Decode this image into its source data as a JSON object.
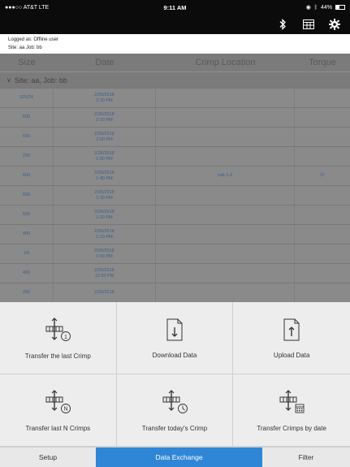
{
  "status_bar": {
    "carrier": "●●●○○ AT&T  LTE",
    "time": "9:11 AM",
    "battery_text": "44%",
    "battery_level": 0.44
  },
  "toolbar": {
    "icons": [
      "bluetooth-icon",
      "calculator-icon",
      "gear-icon"
    ]
  },
  "info": {
    "logged": "Logged as: Offline user",
    "site": "Site: aa Job: bb"
  },
  "table": {
    "headers": [
      "Size",
      "Date",
      "Crimp Location",
      "Torque"
    ],
    "group": "Site: aa, Job: bb",
    "rows": [
      {
        "size": "925/24",
        "date": "2/26/2018",
        "time": "2:20 PM",
        "location": "",
        "torque": ""
      },
      {
        "size": "600",
        "date": "2/26/2018",
        "time": "2:10 PM",
        "location": "",
        "torque": ""
      },
      {
        "size": "600",
        "date": "2/26/2018",
        "time": "2:00 PM",
        "location": "",
        "torque": ""
      },
      {
        "size": "250",
        "date": "2/26/2018",
        "time": "1:50 PM",
        "location": "",
        "torque": ""
      },
      {
        "size": "600",
        "date": "2/26/2018",
        "time": "1:40 PM",
        "location": "cab 1-2",
        "torque": "37"
      },
      {
        "size": "600",
        "date": "2/26/2018",
        "time": "1:30 PM",
        "location": "",
        "torque": ""
      },
      {
        "size": "600",
        "date": "2/26/2018",
        "time": "1:20 PM",
        "location": "",
        "torque": ""
      },
      {
        "size": "400",
        "date": "2/26/2018",
        "time": "1:10 PM",
        "location": "",
        "torque": ""
      },
      {
        "size": "1/0",
        "date": "2/26/2018",
        "time": "1:00 PM",
        "location": "",
        "torque": ""
      },
      {
        "size": "400",
        "date": "2/26/2018",
        "time": "12:50 PM",
        "location": "",
        "torque": ""
      },
      {
        "size": "250",
        "date": "2/26/2018",
        "time": "",
        "location": "",
        "torque": ""
      }
    ]
  },
  "actions": {
    "transfer_last": "Transfer the last Crimp",
    "download": "Download Data",
    "upload": "Upload Data",
    "transfer_n": "Transfer last N Crimps",
    "transfer_today": "Transfer today's Crimp",
    "transfer_date": "Transfer Crimps by date",
    "badge_one": "1",
    "badge_n": "N"
  },
  "tabs": {
    "setup": "Setup",
    "data_exchange": "Data Exchange",
    "filter": "Filter"
  },
  "colors": {
    "accent": "#2f86d6",
    "status_bg": "#0b0b0b",
    "row_text": "#3a5f8f"
  }
}
